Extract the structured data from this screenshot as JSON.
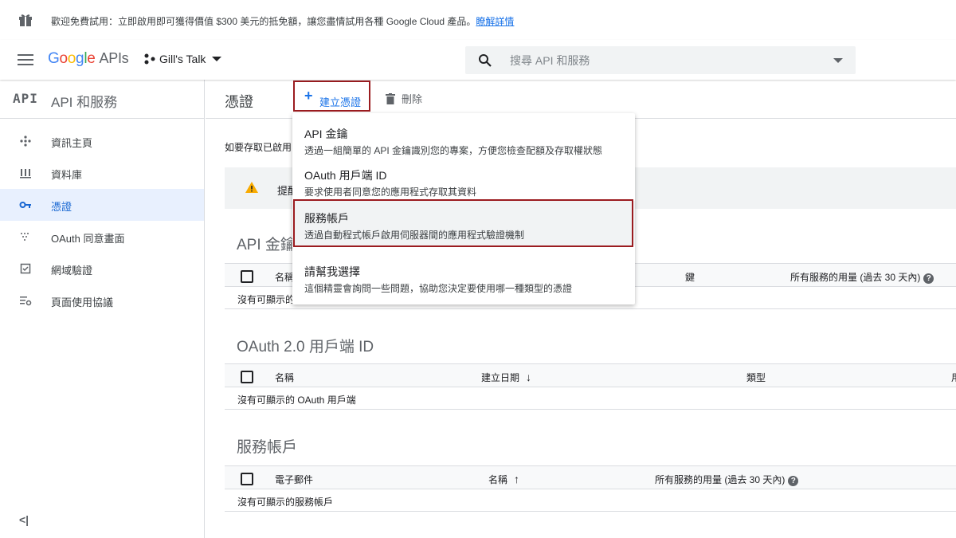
{
  "banner": {
    "text": "歡迎免費試用：立即啟用即可獲得價值 $300 美元的抵免額，讓您盡情試用各種 Google Cloud 產品。",
    "link": "瞭解詳情"
  },
  "topbar": {
    "logo": {
      "g1": "G",
      "g2": "o",
      "g3": "o",
      "g4": "g",
      "g5": "l",
      "g6": "e",
      "apis": "APIs"
    },
    "project": "Gill's Talk",
    "search_placeholder": "搜尋 API 和服務"
  },
  "sidebar": {
    "logo": "API",
    "title": "API 和服務",
    "items": [
      {
        "label": "資訊主頁",
        "icon": "dashboard-icon"
      },
      {
        "label": "資料庫",
        "icon": "library-icon"
      },
      {
        "label": "憑證",
        "icon": "key-icon",
        "active": true
      },
      {
        "label": "OAuth 同意畫面",
        "icon": "consent-icon"
      },
      {
        "label": "網域驗證",
        "icon": "checkbox-icon"
      },
      {
        "label": "頁面使用協議",
        "icon": "settings-list-icon"
      }
    ],
    "collapse": "<|"
  },
  "main": {
    "title": "憑證",
    "create_label": "建立憑證",
    "delete_label": "刪除",
    "intro": "如要存取已啟用",
    "warning": "提醒",
    "sections": [
      {
        "title": "API 金鑰",
        "columns": [
          "名稱",
          "鍵",
          "所有服務的用量 (過去 30 天內)"
        ],
        "empty": "沒有可顯示的"
      },
      {
        "title": "OAuth 2.0 用戶端 ID",
        "columns": [
          "名稱",
          "建立日期",
          "類型",
          "用"
        ],
        "empty": "沒有可顯示的 OAuth 用戶端"
      },
      {
        "title": "服務帳戶",
        "columns": [
          "電子郵件",
          "名稱",
          "所有服務的用量 (過去 30 天內)"
        ],
        "empty": "沒有可顯示的服務帳戶"
      }
    ]
  },
  "dropdown": {
    "items": [
      {
        "title": "API 金鑰",
        "desc": "透過一組簡單的 API 金鑰識別您的專案，方便您檢查配額及存取權狀態"
      },
      {
        "title": "OAuth 用戶端 ID",
        "desc": "要求使用者同意您的應用程式存取其資料"
      },
      {
        "title": "服務帳戶",
        "desc": "透過自動程式帳戶啟用伺服器間的應用程式驗證機制",
        "highlighted": true
      },
      {
        "title": "請幫我選擇",
        "desc": "這個精靈會詢問一些問題，協助您決定要使用哪一種類型的憑證"
      }
    ]
  },
  "colors": {
    "accent": "#1a73e8",
    "highlight_border": "#9b1c20",
    "active_bg": "#e8f0fe"
  }
}
